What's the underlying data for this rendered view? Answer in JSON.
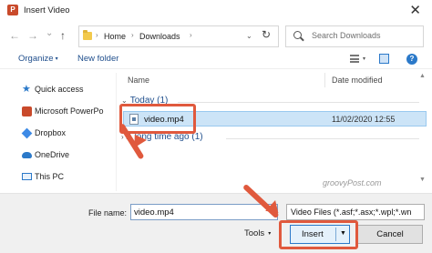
{
  "window": {
    "title": "Insert Video",
    "app_icon_letter": "P",
    "close_glyph": "✕"
  },
  "address_bar": {
    "back_glyph": "←",
    "forward_glyph": "→",
    "recent_glyph": "⌄",
    "up_glyph": "↑",
    "breadcrumb": [
      "Home",
      "Downloads"
    ],
    "separator": "›",
    "dropdown_glyph": "⌄",
    "refresh_glyph": "↻"
  },
  "search": {
    "placeholder": "Search Downloads"
  },
  "toolbar": {
    "organize_label": "Organize",
    "organize_caret": "▾",
    "new_folder_label": "New folder",
    "view_caret": "▾",
    "help_glyph": "?"
  },
  "nav_pane": {
    "items": [
      {
        "label": "Quick access",
        "icon": "star-icon"
      },
      {
        "label": "Microsoft PowerPo",
        "icon": "powerpoint-icon"
      },
      {
        "label": "Dropbox",
        "icon": "dropbox-icon"
      },
      {
        "label": "OneDrive",
        "icon": "onedrive-icon"
      },
      {
        "label": "This PC",
        "icon": "computer-icon"
      }
    ],
    "star_glyph": "★"
  },
  "file_list": {
    "columns": {
      "name": "Name",
      "date": "Date modified"
    },
    "groups": [
      {
        "label": "Today (1)",
        "chevron": "⌄"
      },
      {
        "label": "A long time ago (1)",
        "chevron": "›"
      }
    ],
    "files": [
      {
        "name": "video.mp4",
        "date": "11/02/2020 12:55"
      }
    ]
  },
  "scrollbar": {
    "up_glyph": "▲",
    "down_glyph": "▼"
  },
  "watermark": "groovyPost.com",
  "bottom": {
    "file_name_label": "File name:",
    "file_name_value": "video.mp4",
    "file_type": "Video Files (*.asf;*.asx;*.wpl;*.wn",
    "tools_label": "Tools",
    "tools_caret": "▾",
    "insert_label": "Insert",
    "insert_caret": "▼",
    "cancel_label": "Cancel"
  },
  "colors": {
    "highlight": "#e0593d",
    "selection": "#cce4f7",
    "link": "#1f4e8c"
  }
}
